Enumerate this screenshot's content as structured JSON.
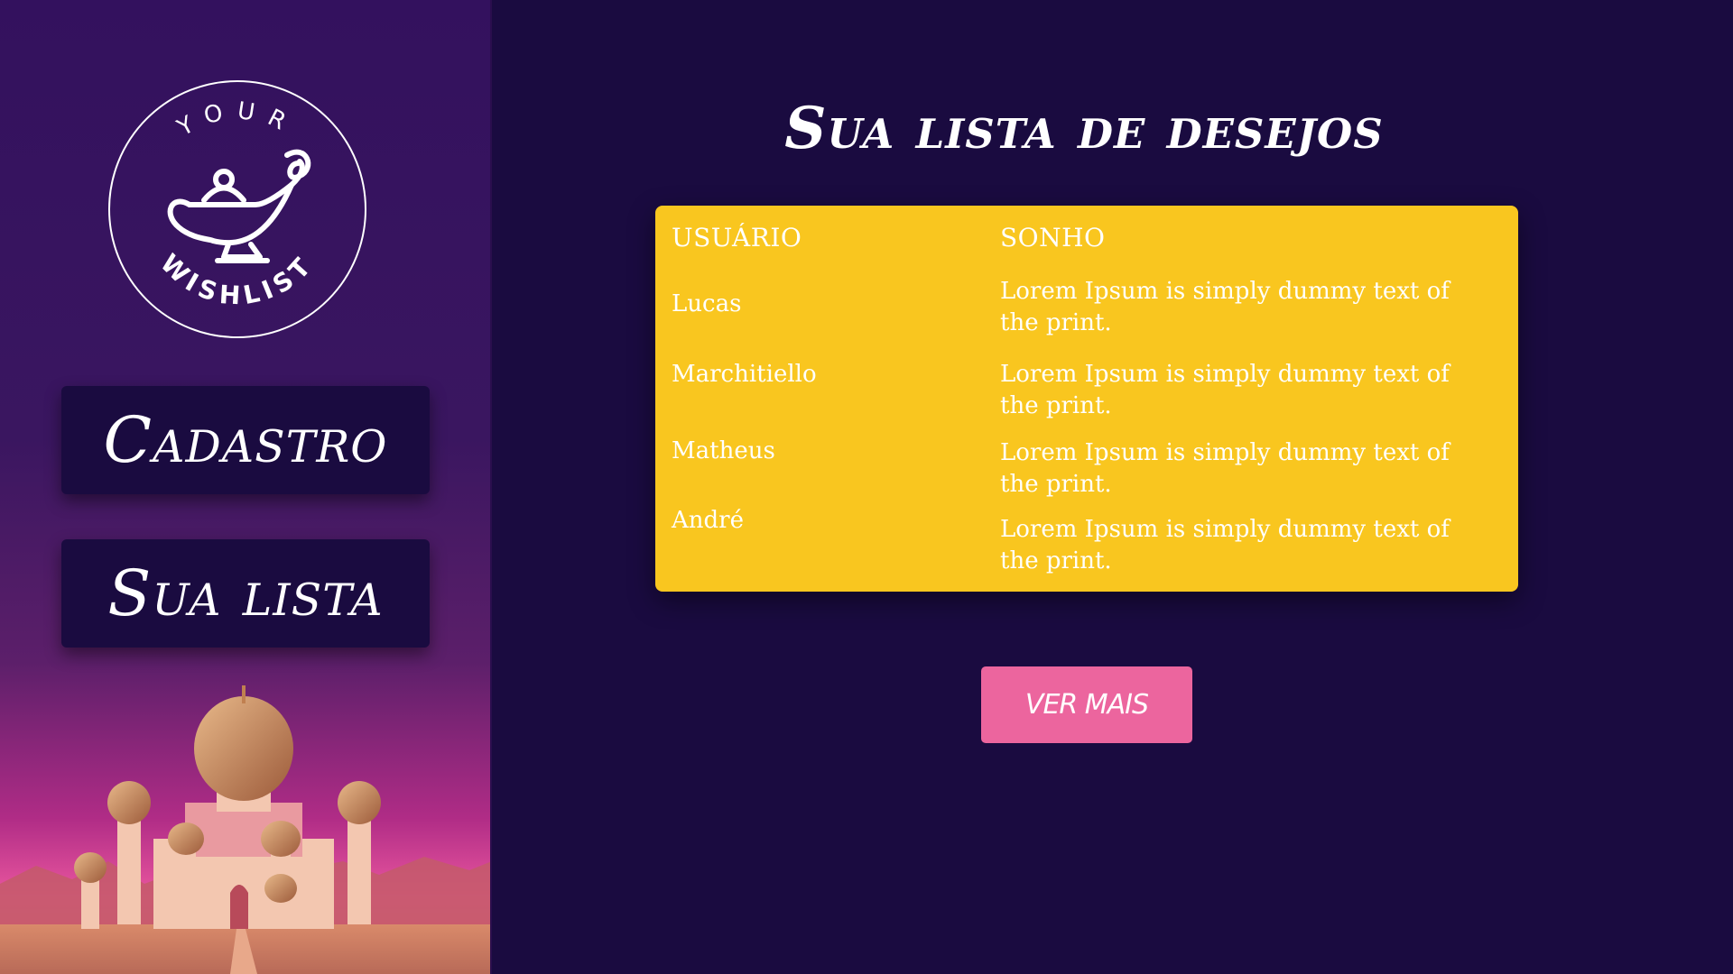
{
  "sidebar": {
    "logo": {
      "top_text": "YOUR",
      "bottom_text": "WISHLIST",
      "icon": "magic-lamp-icon"
    },
    "nav": [
      {
        "label": "Cadastro"
      },
      {
        "label": "Sua lista"
      }
    ],
    "illustration": "palace-illustration"
  },
  "main": {
    "title": "Sua lista de desejos",
    "table": {
      "headers": [
        "USUÁRIO",
        "SONHO"
      ],
      "rows": [
        {
          "user": "Lucas",
          "dream": "Lorem Ipsum is simply dummy text of the print."
        },
        {
          "user": "Marchitiello",
          "dream": "Lorem Ipsum is simply dummy text of the print."
        },
        {
          "user": "Matheus",
          "dream": "Lorem Ipsum is simply dummy text of the print."
        },
        {
          "user": "André",
          "dream": "Lorem Ipsum is simply dummy text of the print."
        }
      ]
    },
    "more_button": "VER MAIS"
  },
  "colors": {
    "background": "#1a0b40",
    "table": "#f9c61f",
    "button": "#ec659e",
    "sidebar_top": "#33115e"
  }
}
